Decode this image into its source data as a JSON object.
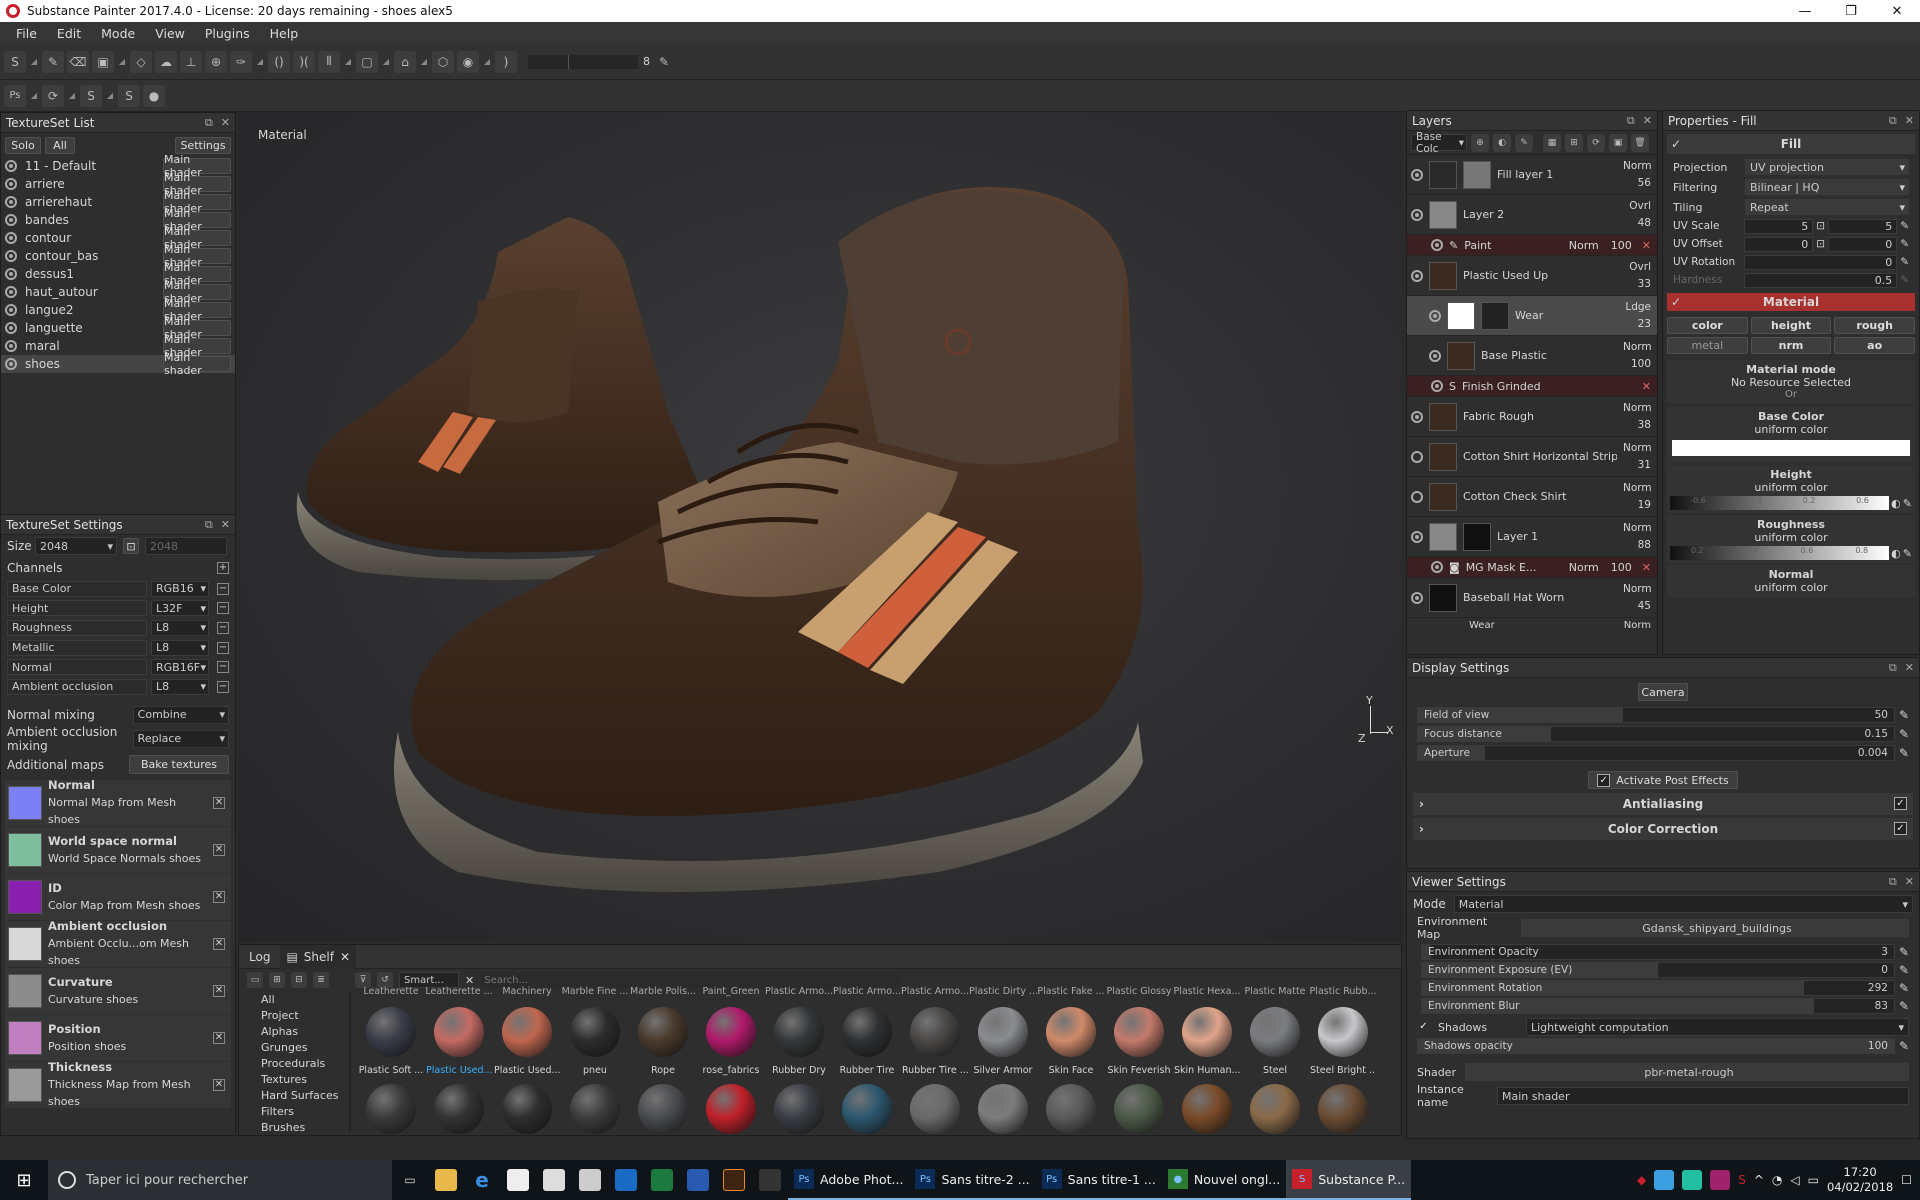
{
  "window": {
    "title": "Substance Painter 2017.4.0 - License: 20 days remaining - shoes alex5"
  },
  "menu": [
    "File",
    "Edit",
    "Mode",
    "View",
    "Plugins",
    "Help"
  ],
  "toolbar": {
    "brush_size": "8"
  },
  "textureset_list": {
    "title": "TextureSet List",
    "solo": "Solo",
    "all": "All",
    "settings": "Settings",
    "items": [
      {
        "name": "11 - Default",
        "shader": "Main shader"
      },
      {
        "name": "arriere",
        "shader": "Main shader"
      },
      {
        "name": "arrierehaut",
        "shader": "Main shader"
      },
      {
        "name": "bandes",
        "shader": "Main shader"
      },
      {
        "name": "contour",
        "shader": "Main shader"
      },
      {
        "name": "contour_bas",
        "shader": "Main shader"
      },
      {
        "name": "dessus1",
        "shader": "Main shader"
      },
      {
        "name": "haut_autour",
        "shader": "Main shader"
      },
      {
        "name": "langue2",
        "shader": "Main shader"
      },
      {
        "name": "languette",
        "shader": "Main shader"
      },
      {
        "name": "maral",
        "shader": "Main shader"
      },
      {
        "name": "shoes",
        "shader": "Main shader"
      }
    ]
  },
  "textureset_settings": {
    "title": "TextureSet Settings",
    "size_label": "Size",
    "size": "2048",
    "size2": "2048",
    "channels_label": "Channels",
    "channels": [
      {
        "name": "Base Color",
        "format": "RGB16"
      },
      {
        "name": "Height",
        "format": "L32F"
      },
      {
        "name": "Roughness",
        "format": "L8"
      },
      {
        "name": "Metallic",
        "format": "L8"
      },
      {
        "name": "Normal",
        "format": "RGB16F"
      },
      {
        "name": "Ambient occlusion",
        "format": "L8"
      }
    ],
    "normal_mixing_label": "Normal mixing",
    "normal_mixing": "Combine",
    "ao_mixing_label": "Ambient occlusion mixing",
    "ao_mixing": "Replace",
    "additional_maps_label": "Additional maps",
    "bake_label": "Bake textures",
    "maps": [
      {
        "name": "Normal",
        "desc": "Normal Map from Mesh shoes",
        "color": "#7b80f5"
      },
      {
        "name": "World space normal",
        "desc": "World Space Normals shoes",
        "color": "#7fbfa0"
      },
      {
        "name": "ID",
        "desc": "Color Map from Mesh shoes",
        "color": "#8a1fb0"
      },
      {
        "name": "Ambient occlusion",
        "desc": "Ambient Occlu...om Mesh shoes",
        "color": "#d8d8d8"
      },
      {
        "name": "Curvature",
        "desc": "Curvature shoes",
        "color": "#8c8c8c"
      },
      {
        "name": "Position",
        "desc": "Position shoes",
        "color": "#c07fc0"
      },
      {
        "name": "Thickness",
        "desc": "Thickness Map from Mesh shoes",
        "color": "#9a9a9a"
      }
    ]
  },
  "viewport": {
    "label": "Material",
    "axis_x": "X",
    "axis_y": "Y",
    "axis_z": "Z"
  },
  "shelf": {
    "log_tab": "Log",
    "shelf_tab": "Shelf",
    "filter": "Smart...",
    "search_placeholder": "Search...",
    "categories": [
      "All",
      "Project",
      "Alphas",
      "Grunges",
      "Procedurals",
      "Textures",
      "Hard Surfaces",
      "Filters",
      "Brushes"
    ],
    "top_labels": [
      "Leatherette",
      "Leatherette ...",
      "Machinery",
      "Marble Fine ...",
      "Marble Polis...",
      "Paint_Green",
      "Plastic Armo...",
      "Plastic Armo...",
      "Plastic Armo...",
      "Plastic Dirty ...",
      "Plastic Fake ...",
      "Plastic Glossy",
      "Plastic Hexa...",
      "Plastic Matte",
      "Plastic Rubb..."
    ],
    "row1": [
      {
        "label": "Plastic Soft ...",
        "color": "#3a3d48"
      },
      {
        "label": "Plastic Used...",
        "color": "#c46a63"
      },
      {
        "label": "Plastic Used...",
        "color": "#c0664e"
      },
      {
        "label": "pneu",
        "color": "#2c2c2e"
      },
      {
        "label": "Rope",
        "color": "#4a3a2c"
      },
      {
        "label": "rose_fabrics",
        "color": "#b01a6a"
      },
      {
        "label": "Rubber Dry",
        "color": "#35383a"
      },
      {
        "label": "Rubber Tire",
        "color": "#2e3032"
      },
      {
        "label": "Rubber Tire ...",
        "color": "#4a4846"
      },
      {
        "label": "Silver Armor",
        "color": "#8a8c90"
      },
      {
        "label": "Skin Face",
        "color": "#d08a6a"
      },
      {
        "label": "Skin Feverish",
        "color": "#c47a6c"
      },
      {
        "label": "Skin Human...",
        "color": "#e0a48a"
      },
      {
        "label": "Steel",
        "color": "#7a7c80"
      },
      {
        "label": "Steel Bright ...",
        "color": "#c8c8cc"
      }
    ],
    "row2_colors": [
      "#3a3a3a",
      "#333",
      "#2e2e30",
      "#3c3c3c",
      "#4a4c50",
      "#c0202a",
      "#3a3d44",
      "#2c5870",
      "#6a6a6a",
      "#7c7c7c",
      "#5a5a5a",
      "#4c5a48",
      "#7a4a28",
      "#8a6a48",
      "#6a4c34"
    ]
  },
  "layers": {
    "title": "Layers",
    "channel": "Base Colc",
    "items": [
      {
        "name": "Fill layer 1",
        "blend": "Norm",
        "opacity": "56",
        "thumb": "#2a2a2a",
        "mask": "#777"
      },
      {
        "name": "Layer 2",
        "blend": "Ovrl",
        "opacity": "48",
        "thumb": "#888",
        "mask": ""
      },
      {
        "name": "Plastic Used Up",
        "blend": "Ovrl",
        "opacity": "33",
        "thumb": "#3a2a20",
        "mask": ""
      },
      {
        "name": "Wear",
        "blend": "Ldge",
        "opacity": "23",
        "thumb": "#fff",
        "mask": "#222"
      },
      {
        "name": "Base Plastic",
        "blend": "Norm",
        "opacity": "100",
        "thumb": "#3a2a20",
        "mask": ""
      },
      {
        "name": "Fabric Rough",
        "blend": "Norm",
        "opacity": "38",
        "thumb": "#3a2a20",
        "mask": ""
      },
      {
        "name": "Cotton Shirt Horizontal Stripes",
        "blend": "Norm",
        "opacity": "31",
        "thumb": "#3a2a20",
        "mask": ""
      },
      {
        "name": "Cotton Check Shirt",
        "blend": "Norm",
        "opacity": "19",
        "thumb": "#3a2a20",
        "mask": ""
      },
      {
        "name": "Layer 1",
        "blend": "Norm",
        "opacity": "88",
        "thumb": "#888",
        "mask": "#111"
      },
      {
        "name": "Baseball Hat Worn",
        "blend": "Norm",
        "opacity": "45",
        "thumb": "#111",
        "mask": ""
      }
    ],
    "paint": {
      "name": "Paint",
      "blend": "Norm",
      "opacity": "100"
    },
    "finish": {
      "name": "Finish Grinded"
    },
    "mgmask": {
      "name": "MG Mask E...",
      "blend": "Norm",
      "opacity": "100"
    },
    "last_blend": "Norm",
    "last_name": "Wear"
  },
  "properties": {
    "title": "Properties - Fill",
    "fill_label": "Fill",
    "projection_label": "Projection",
    "projection": "UV projection",
    "filtering_label": "Filtering",
    "filtering": "Bilinear | HQ",
    "tiling_label": "Tiling",
    "tiling": "Repeat",
    "uvscale_label": "UV Scale",
    "uvscale_a": "5",
    "uvscale_b": "5",
    "uvoffset_label": "UV Offset",
    "uvoffset_a": "0",
    "uvoffset_b": "0",
    "uvrotation_label": "UV Rotation",
    "uvrotation": "0",
    "hardness_label": "Hardness",
    "hardness": "0.5",
    "material_label": "Material",
    "channels": [
      "color",
      "height",
      "rough",
      "metal",
      "nrm",
      "ao"
    ],
    "material_mode_label": "Material mode",
    "material_mode": "No Resource Selected",
    "or": "Or",
    "base_color_label": "Base Color",
    "base_color_sub": "uniform color",
    "height_label": "Height",
    "height_sub": "uniform color",
    "roughness_label": "Roughness",
    "roughness_sub": "uniform color",
    "normal_label": "Normal",
    "normal_sub": "uniform color",
    "slider_ticks": [
      "-0.6",
      "-0.2",
      "0.2",
      "0.6"
    ],
    "rough_ticks": [
      "0.2",
      "0.4",
      "0.6",
      "0.8"
    ]
  },
  "display": {
    "title": "Display Settings",
    "camera": "Camera",
    "fov_label": "Field of view",
    "fov": "50",
    "fov_level": 0.43,
    "focus_label": "Focus distance",
    "focus": "0.15",
    "focus_level": 0.28,
    "aperture_label": "Aperture",
    "aperture": "0.004",
    "aperture_level": 0.14,
    "post_effects": "Activate Post Effects",
    "antialiasing": "Antialiasing",
    "color_correction": "Color Correction"
  },
  "viewer": {
    "title": "Viewer Settings",
    "mode_label": "Mode",
    "mode": "Material",
    "env_map_label": "Environment Map",
    "env_map": "Gdansk_shipyard_buildings",
    "sliders": [
      {
        "label": "Environment Opacity",
        "value": "3",
        "level": 0.02
      },
      {
        "label": "Environment Exposure (EV)",
        "value": "0",
        "level": 0.5
      },
      {
        "label": "Environment Rotation",
        "value": "292",
        "level": 0.81
      },
      {
        "label": "Environment Blur",
        "value": "83",
        "level": 0.83
      }
    ],
    "shadows_label": "Shadows",
    "shadows": "Lightweight computation",
    "shadows_opacity_label": "Shadows opacity",
    "shadows_opacity": "100",
    "shader_label": "Shader",
    "shader": "pbr-metal-rough",
    "instance_label": "Instance name",
    "instance": "Main shader"
  },
  "taskbar": {
    "search": "Taper ici pour rechercher",
    "apps": [
      {
        "label": "Adobe Phot...",
        "icon": "Ps",
        "color": "#0b2a55"
      },
      {
        "label": "Sans titre-2 ...",
        "icon": "Ps",
        "color": "#0b2a55"
      },
      {
        "label": "Sans titre-1 ...",
        "icon": "Ps",
        "color": "#0b2a55"
      },
      {
        "label": "Nouvel ongl...",
        "icon": "●",
        "color": "#2a7a30"
      },
      {
        "label": "Substance P...",
        "icon": "S",
        "color": "#c8202a"
      }
    ],
    "time": "17:20",
    "date": "04/02/2018"
  }
}
